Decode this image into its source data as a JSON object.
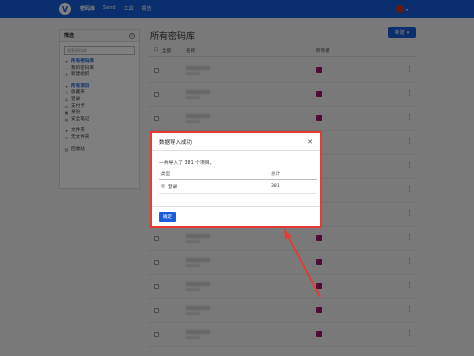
{
  "topbar": {
    "logo": "V",
    "nav": [
      "密码库",
      "Send",
      "工具",
      "报告"
    ]
  },
  "sidebar": {
    "title": "筛选",
    "search_placeholder": "搜索密码库",
    "groups": [
      {
        "items": [
          {
            "label": "所有密码库",
            "icon": "vault-icon",
            "active": true
          },
          {
            "label": "我的密码库",
            "icon": "user-icon",
            "active": false
          },
          {
            "label": "新建组织",
            "icon": "plus-icon",
            "active": false
          }
        ]
      },
      {
        "items": [
          {
            "label": "所有项目",
            "icon": "grid-icon",
            "active": true
          },
          {
            "label": "收藏夹",
            "icon": "star-icon",
            "active": false
          },
          {
            "label": "登录",
            "icon": "globe-icon",
            "active": false
          },
          {
            "label": "支付卡",
            "icon": "card-icon",
            "active": false
          },
          {
            "label": "身份",
            "icon": "id-icon",
            "active": false
          },
          {
            "label": "安全笔记",
            "icon": "note-icon",
            "active": false
          }
        ]
      },
      {
        "items": [
          {
            "label": "文件夹",
            "icon": "folder-icon",
            "active": false
          },
          {
            "label": "无文件夹",
            "icon": "folder-icon",
            "active": false
          }
        ]
      },
      {
        "items": [
          {
            "label": "回收站",
            "icon": "trash-icon",
            "active": false
          }
        ]
      }
    ]
  },
  "main": {
    "title": "所有密码库",
    "new_button": "新建",
    "columns": {
      "all": "全部",
      "name": "名称",
      "owner": "所有者"
    }
  },
  "dialog": {
    "title": "数据导入成功",
    "message": "一共导入了 381 个项目。",
    "col_type": "类型",
    "col_total": "总计",
    "rows": [
      {
        "type": "登录",
        "total": "381"
      }
    ],
    "ok_button": "确定"
  },
  "colors": {
    "brand": "#175ddc",
    "owner_tag": "#a0176f",
    "highlight": "#e53935"
  }
}
